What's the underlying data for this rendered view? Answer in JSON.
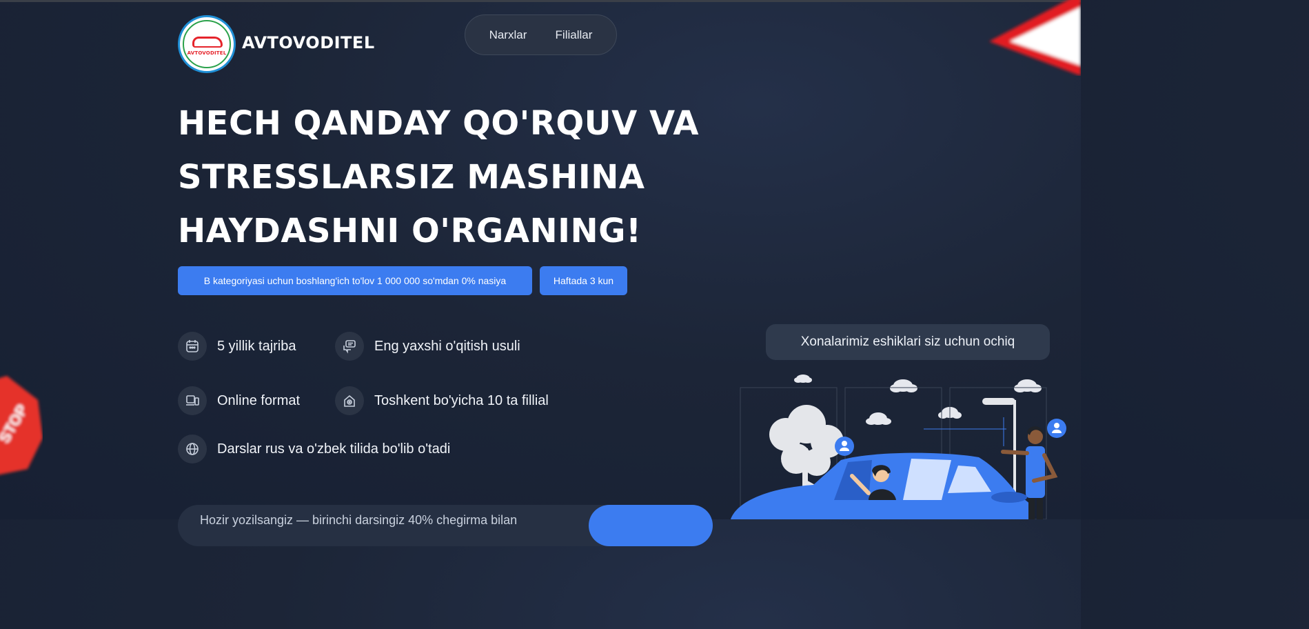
{
  "header": {
    "logo_text": "AVTOVODITEL",
    "brand": "AVTOVODITEL",
    "nav": [
      {
        "label": "Narxlar"
      },
      {
        "label": "Filiallar"
      }
    ]
  },
  "hero": {
    "headline": [
      "HECH QANDAY QO'RQUV VA",
      "STRESSLARSIZ MASHINA",
      "HAYDASHNI O'RGANING!"
    ],
    "badges": [
      {
        "label": "B kategoriyasi uchun boshlang'ich to'lov 1 000 000 so'mdan 0% nasiya"
      },
      {
        "label": "Haftada 3 kun"
      }
    ],
    "features": [
      {
        "icon": "calendar-icon",
        "label": "5 yillik tajriba"
      },
      {
        "icon": "chat-icon",
        "label": "Eng yaxshi o'qitish usuli"
      },
      {
        "icon": "devices-icon",
        "label": "Online format"
      },
      {
        "icon": "location-icon",
        "label": "Toshkent bo'yicha 10 ta fillial"
      },
      {
        "icon": "globe-icon",
        "label": "Darslar rus va o'zbek tilida bo'lib o'tadi"
      }
    ],
    "bottom_text": "Hozir yozilsangiz — birinchi darsingiz 40% chegirma bilan"
  },
  "side": {
    "open_doors": "Xonalarimiz eshiklari siz uchun ochiq"
  },
  "colors": {
    "accent": "#3c7cf0",
    "background": "#1c2537",
    "panel": "#2f3a4d"
  }
}
